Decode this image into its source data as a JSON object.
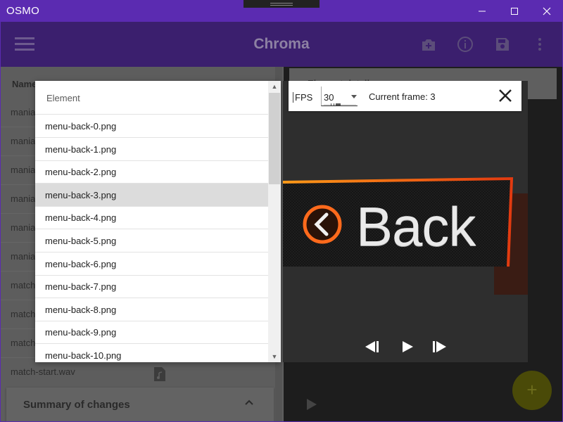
{
  "window": {
    "title": "OSMO"
  },
  "appbar": {
    "title": "Chroma",
    "icons": [
      "menu-icon",
      "add-icon",
      "info-icon",
      "save-icon",
      "more-icon"
    ]
  },
  "left_panel": {
    "header": "Name",
    "rows": [
      "mania",
      "mania",
      "mania",
      "mania",
      "mania",
      "mania",
      "match",
      "match",
      "match"
    ],
    "file": "match-start.wav",
    "summary_label": "Summary of changes"
  },
  "right_panel": {
    "card_label": "Element details"
  },
  "dropdown": {
    "header": "Element",
    "items": [
      "menu-back-0.png",
      "menu-back-1.png",
      "menu-back-2.png",
      "menu-back-3.png",
      "menu-back-4.png",
      "menu-back-5.png",
      "menu-back-6.png",
      "menu-back-7.png",
      "menu-back-8.png",
      "menu-back-9.png",
      "menu-back-10.png"
    ],
    "selected_index": 3
  },
  "viewer": {
    "fps_label": "FPS",
    "fps_value": "30",
    "current_frame": "Current frame: 3",
    "preview_text": "Back"
  },
  "colors": {
    "accent": "#5b2bb1",
    "orange": "#ff5a14"
  }
}
